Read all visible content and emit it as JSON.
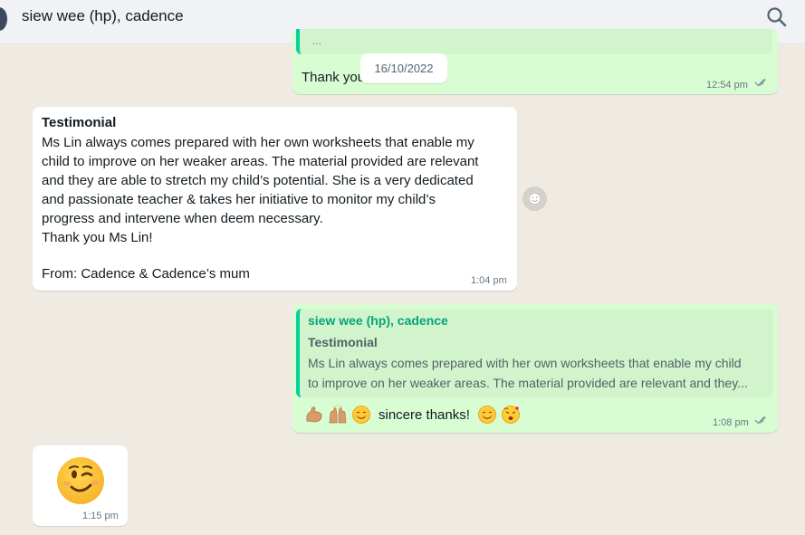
{
  "header": {
    "contact_name": "siew wee (hp), cadence",
    "search_icon": "search-icon"
  },
  "date_chip": "16/10/2022",
  "messages": [
    {
      "direction": "outgoing",
      "text_visible": "Thank you",
      "ellipsis": "...",
      "time": "12:54 pm",
      "status": "read"
    },
    {
      "direction": "incoming",
      "title": "Testimonial",
      "lines": [
        "Ms Lin always comes prepared with her own worksheets that enable my",
        "child to improve on her weaker areas. The material provided are relevant",
        "and they are able to stretch my child’s potential. She is a very dedicated",
        "and passionate teacher & takes her initiative to monitor my child’s",
        "progress and intervene when deem necessary.",
        "Thank you Ms Lin!",
        "",
        "From: Cadence & Cadence’s mum"
      ],
      "time": "1:04 pm"
    },
    {
      "direction": "outgoing",
      "quote": {
        "author": "siew wee (hp), cadence",
        "title": "Testimonial",
        "lines": [
          "Ms Lin always comes prepared with her own worksheets that enable my child",
          "to improve on her weaker areas. The material provided are relevant and they..."
        ]
      },
      "text": "sincere thanks!",
      "emoji_before": [
        "flexed-biceps",
        "raising-hands",
        "smiling-face"
      ],
      "emoji_after": [
        "smiling-face",
        "face-blowing-kiss"
      ],
      "time": "1:08 pm",
      "status": "read"
    },
    {
      "direction": "incoming",
      "emoji": "winking-face",
      "time": "1:15 pm"
    }
  ],
  "colors": {
    "background": "#efeae2",
    "outgoing_bubble": "#d9fdd3",
    "incoming_bubble": "#ffffff",
    "read_ticks": "#53bdeb",
    "quote_accent": "#06cf9c"
  }
}
